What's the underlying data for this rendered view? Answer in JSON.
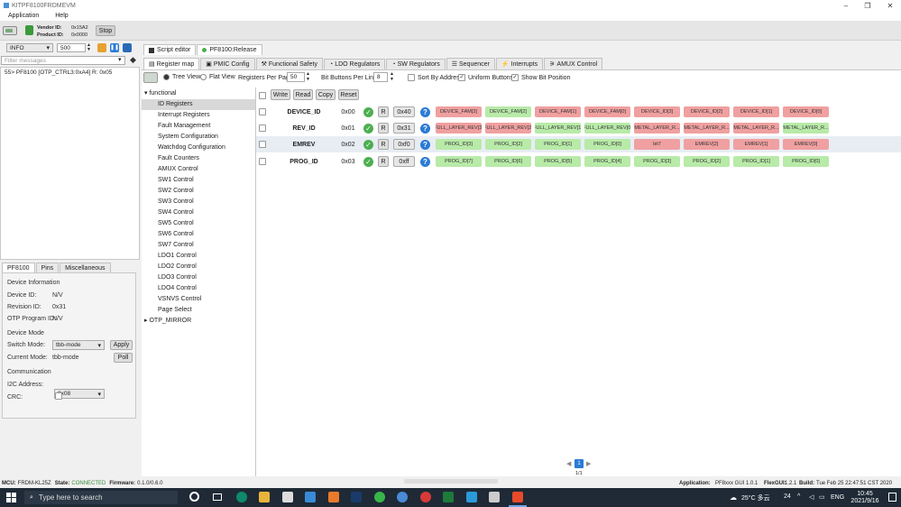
{
  "window": {
    "title": "KITPF8100FRDMEVM"
  },
  "menu": {
    "items": [
      "Application",
      "Help"
    ]
  },
  "device": {
    "vendor_label": "Vendor ID:",
    "vendor_value": "0x15A2",
    "product_label": "Product ID:",
    "product_value": "0x0000",
    "stop_label": "Stop"
  },
  "log": {
    "level": "INFO",
    "count": "500",
    "filter_placeholder": "Filter messages",
    "lines": [
      "55> PF8100 [OTP_CTRL3:0xA4] R: 0x05"
    ]
  },
  "editor_tabs": {
    "script_editor": "Script editor",
    "release": "PF8100:Release"
  },
  "main_tabs": [
    "Register map",
    "PMIC Config",
    "Functional Safety",
    "LDO Regulators",
    "SW Regulators",
    "Sequencer",
    "Interrupts",
    "AMUX Control"
  ],
  "view_opts": {
    "tree_view": "Tree View",
    "flat_view": "Flat View",
    "per_page_label": "Registers Per Page",
    "per_page_value": "50",
    "bits_label": "Bit Buttons Per Line",
    "bits_value": "8",
    "sort_label": "Sort By Address",
    "uniform_label": "Uniform Buttons",
    "show_bit_label": "Show Bit Position"
  },
  "actions": {
    "write": "Write",
    "read": "Read",
    "copy": "Copy",
    "reset": "Reset"
  },
  "tree": {
    "root": "functional",
    "items": [
      "ID Registers",
      "Interrupt Registers",
      "Fault Management",
      "System Configuration",
      "Watchdog Configuration",
      "Fault Counters",
      "AMUX Control",
      "SW1 Control",
      "SW2 Control",
      "SW3 Control",
      "SW4 Control",
      "SW5 Control",
      "SW6 Control",
      "SW7 Control",
      "LDO1 Control",
      "LDO2 Control",
      "LDO3 Control",
      "LDO4 Control",
      "VSNVS Control",
      "Page Select"
    ],
    "collapsed": "OTP_MIRROR"
  },
  "registers": [
    {
      "name": "DEVICE_ID",
      "addr": "0x00",
      "r": "R",
      "value": "0x40",
      "bits": [
        [
          "DEVICE_FAM[3]",
          "r"
        ],
        [
          "DEVICE_FAM[2]",
          "g"
        ],
        [
          "DEVICE_FAM[1]",
          "r"
        ],
        [
          "DEVICE_FAM[0]",
          "r"
        ],
        [
          "DEVICE_ID[3]",
          "r"
        ],
        [
          "DEVICE_ID[2]",
          "r"
        ],
        [
          "DEVICE_ID[1]",
          "r"
        ],
        [
          "DEVICE_ID[0]",
          "r"
        ]
      ]
    },
    {
      "name": "REV_ID",
      "addr": "0x01",
      "r": "R",
      "value": "0x31",
      "bits": [
        [
          "FULL_LAYER_REV[3]",
          "r"
        ],
        [
          "FULL_LAYER_REV[2]",
          "r"
        ],
        [
          "FULL_LAYER_REV[1]",
          "g"
        ],
        [
          "FULL_LAYER_REV[0]",
          "g"
        ],
        [
          "METAL_LAYER_R...",
          "r"
        ],
        [
          "METAL_LAYER_R...",
          "r"
        ],
        [
          "METAL_LAYER_R...",
          "r"
        ],
        [
          "METAL_LAYER_R...",
          "g"
        ]
      ]
    },
    {
      "name": "EMREV",
      "addr": "0x02",
      "r": "R",
      "value": "0xf0",
      "bits": [
        [
          "PROG_ID[3]",
          "g"
        ],
        [
          "PROG_ID[2]",
          "g"
        ],
        [
          "PROG_ID[1]",
          "g"
        ],
        [
          "PROG_ID[0]",
          "g"
        ],
        [
          "bit7",
          "r"
        ],
        [
          "EMREV[2]",
          "r"
        ],
        [
          "EMREV[1]",
          "r"
        ],
        [
          "EMREV[0]",
          "r"
        ]
      ]
    },
    {
      "name": "PROG_ID",
      "addr": "0x03",
      "r": "R",
      "value": "0xff",
      "bits": [
        [
          "PROG_ID[7]",
          "g"
        ],
        [
          "PROG_ID[6]",
          "g"
        ],
        [
          "PROG_ID[5]",
          "g"
        ],
        [
          "PROG_ID[4]",
          "g"
        ],
        [
          "PROG_ID[3]",
          "g"
        ],
        [
          "PROG_ID[2]",
          "g"
        ],
        [
          "PROG_ID[1]",
          "g"
        ],
        [
          "PROG_ID[0]",
          "g"
        ]
      ]
    }
  ],
  "bottom_tabs": [
    "PF8100",
    "Pins",
    "Miscellaneous"
  ],
  "device_info": {
    "section": "Device Information",
    "dev_id_label": "Device ID:",
    "dev_id": "N/V",
    "rev_id_label": "Revision ID:",
    "rev_id": "0x31",
    "otp_label": "OTP Program ID:",
    "otp": "N/V"
  },
  "device_mode": {
    "section": "Device Mode",
    "switch_label": "Switch Mode:",
    "switch_value": "tbb-mode",
    "apply": "Apply",
    "current_label": "Current Mode:",
    "current_value": "tbb-mode",
    "poll": "Poll"
  },
  "comm": {
    "section": "Communication",
    "i2c_label": "I2C Address:",
    "i2c_value": "0x08",
    "crc_label": "CRC:"
  },
  "pager": {
    "page": "1",
    "of": "1/1"
  },
  "status": {
    "mcu_label": "MCU:",
    "mcu": "FRDM-KL25Z",
    "state_label": "State:",
    "state": "CONNECTED",
    "fw_label": "Firmware:",
    "fw": "0.1.0/0.6.0",
    "app_label": "Application:",
    "app": "PF8xxx GUI 1.0.1",
    "flex_label": "FlexGUI:",
    "flex": "1.2.1",
    "build_label": "Build:",
    "build": "Tue Feb 25 22:47:51 CST 2020"
  },
  "taskbar": {
    "search": "Type here to search",
    "weather": "25°C 多云",
    "time": "10:45",
    "date": "2021/9/16",
    "lang": "ENG",
    "num": "24"
  },
  "colors": {
    "green": "#4caf50",
    "blue": "#2a7ad5",
    "red_bit": "#f0a0a0",
    "green_bit": "#b8eaa8",
    "taskbar": "#1f2a36"
  }
}
